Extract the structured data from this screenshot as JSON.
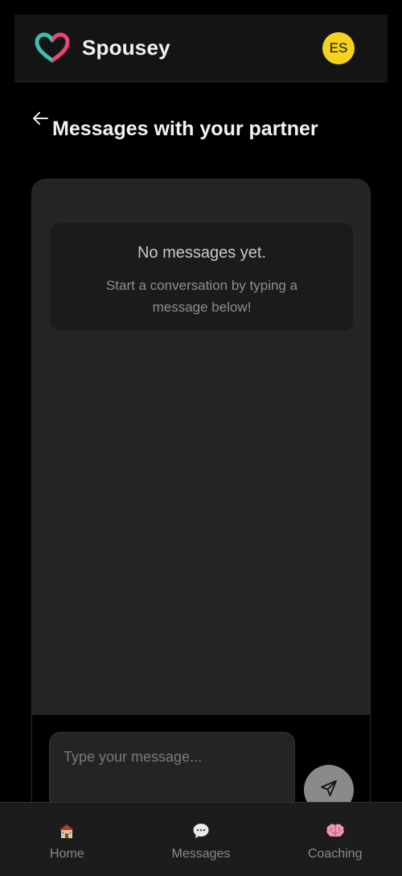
{
  "header": {
    "brand": "Spousey",
    "avatar_initials": "ES",
    "logo_icon": "heart-logo-icon",
    "avatar_color": "#f5d21f"
  },
  "title_row": {
    "back_icon": "arrow-left-icon",
    "title": "Messages with your partner"
  },
  "chat": {
    "empty_title": "No messages yet.",
    "empty_subtitle": "Start a conversation by typing a message below!",
    "input_placeholder": "Type your message...",
    "input_value": "",
    "send_icon": "paper-plane-icon"
  },
  "nav": {
    "items": [
      {
        "label": "Home",
        "icon": "house-icon"
      },
      {
        "label": "Messages",
        "icon": "speech-bubble-icon"
      },
      {
        "label": "Coaching",
        "icon": "brain-icon"
      }
    ]
  },
  "colors": {
    "background": "#000000",
    "panel": "#242424",
    "card": "#1b1b1b",
    "logo_teal": "#3fbfb0",
    "logo_pink": "#e8457a",
    "send_button": "#8a8a8a"
  }
}
